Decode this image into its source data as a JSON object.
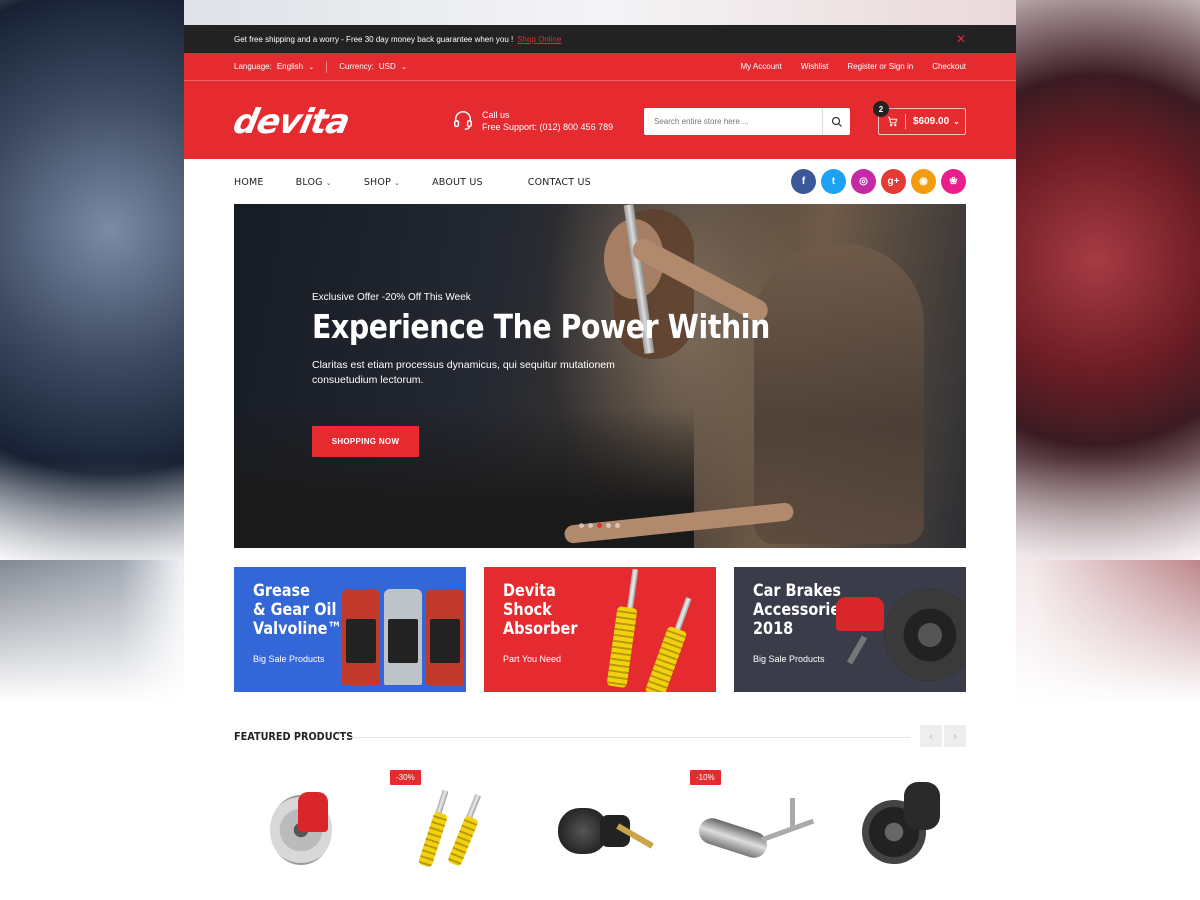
{
  "topbar": {
    "message": "Get free shipping and a worry - Free 30 day money back guarantee when you !",
    "link": "Shop Online",
    "close": "✕"
  },
  "header": {
    "language_label": "Language:",
    "language_value": "English",
    "currency_label": "Currency:",
    "currency_value": "USD",
    "links": [
      "My Account",
      "Wishlist",
      "Register or Sign in",
      "Checkout"
    ],
    "logo": "devita",
    "support_line1": "Call us",
    "support_line2": "Free Support: (012) 800 456 789",
    "search_placeholder": "Search entire store here ...",
    "cart_count": "2",
    "cart_total": "$609.00"
  },
  "nav": {
    "items": [
      "HOME",
      "BLOG",
      "SHOP",
      "ABOUT US",
      "CONTACT US"
    ]
  },
  "socials": [
    {
      "name": "facebook",
      "glyph": "f",
      "color": "#3b5998"
    },
    {
      "name": "twitter",
      "glyph": "t",
      "color": "#1da1f2"
    },
    {
      "name": "instagram",
      "glyph": "◎",
      "color": "#c32aa3"
    },
    {
      "name": "google-plus",
      "glyph": "g+",
      "color": "#e53935"
    },
    {
      "name": "rss",
      "glyph": "◉",
      "color": "#f39c12"
    },
    {
      "name": "dribbble",
      "glyph": "❀",
      "color": "#e91e8c"
    }
  ],
  "hero": {
    "pretitle": "Exclusive Offer -20% Off This Week",
    "title": "Experience The Power Within",
    "text": "Claritas est etiam processus dynamicus, qui sequitur mutationem consuetudium lectorum.",
    "button": "SHOPPING NOW",
    "slides": 5,
    "active_slide": 3
  },
  "banners": [
    {
      "title": "Grease\n& Gear Oil\nValvoline™",
      "subtitle": "Big Sale Products",
      "color": "#3366d6"
    },
    {
      "title": "Devita\nShock\nAbsorber",
      "subtitle": "Part You Need",
      "color": "#e52b2f"
    },
    {
      "title": "Car Brakes\nAccessories\n2018",
      "subtitle": "Big Sale Products",
      "color": "#3b3c4a"
    }
  ],
  "featured": {
    "title": "FEATURED PRODUCTS",
    "prev": "‹",
    "next": "›",
    "products": [
      {
        "name": "brake-disc",
        "sale": ""
      },
      {
        "name": "shock-absorbers",
        "sale": "-30%"
      },
      {
        "name": "brake-chamber",
        "sale": ""
      },
      {
        "name": "exhaust-muffler",
        "sale": "-10%"
      },
      {
        "name": "brake-drum",
        "sale": ""
      }
    ]
  }
}
